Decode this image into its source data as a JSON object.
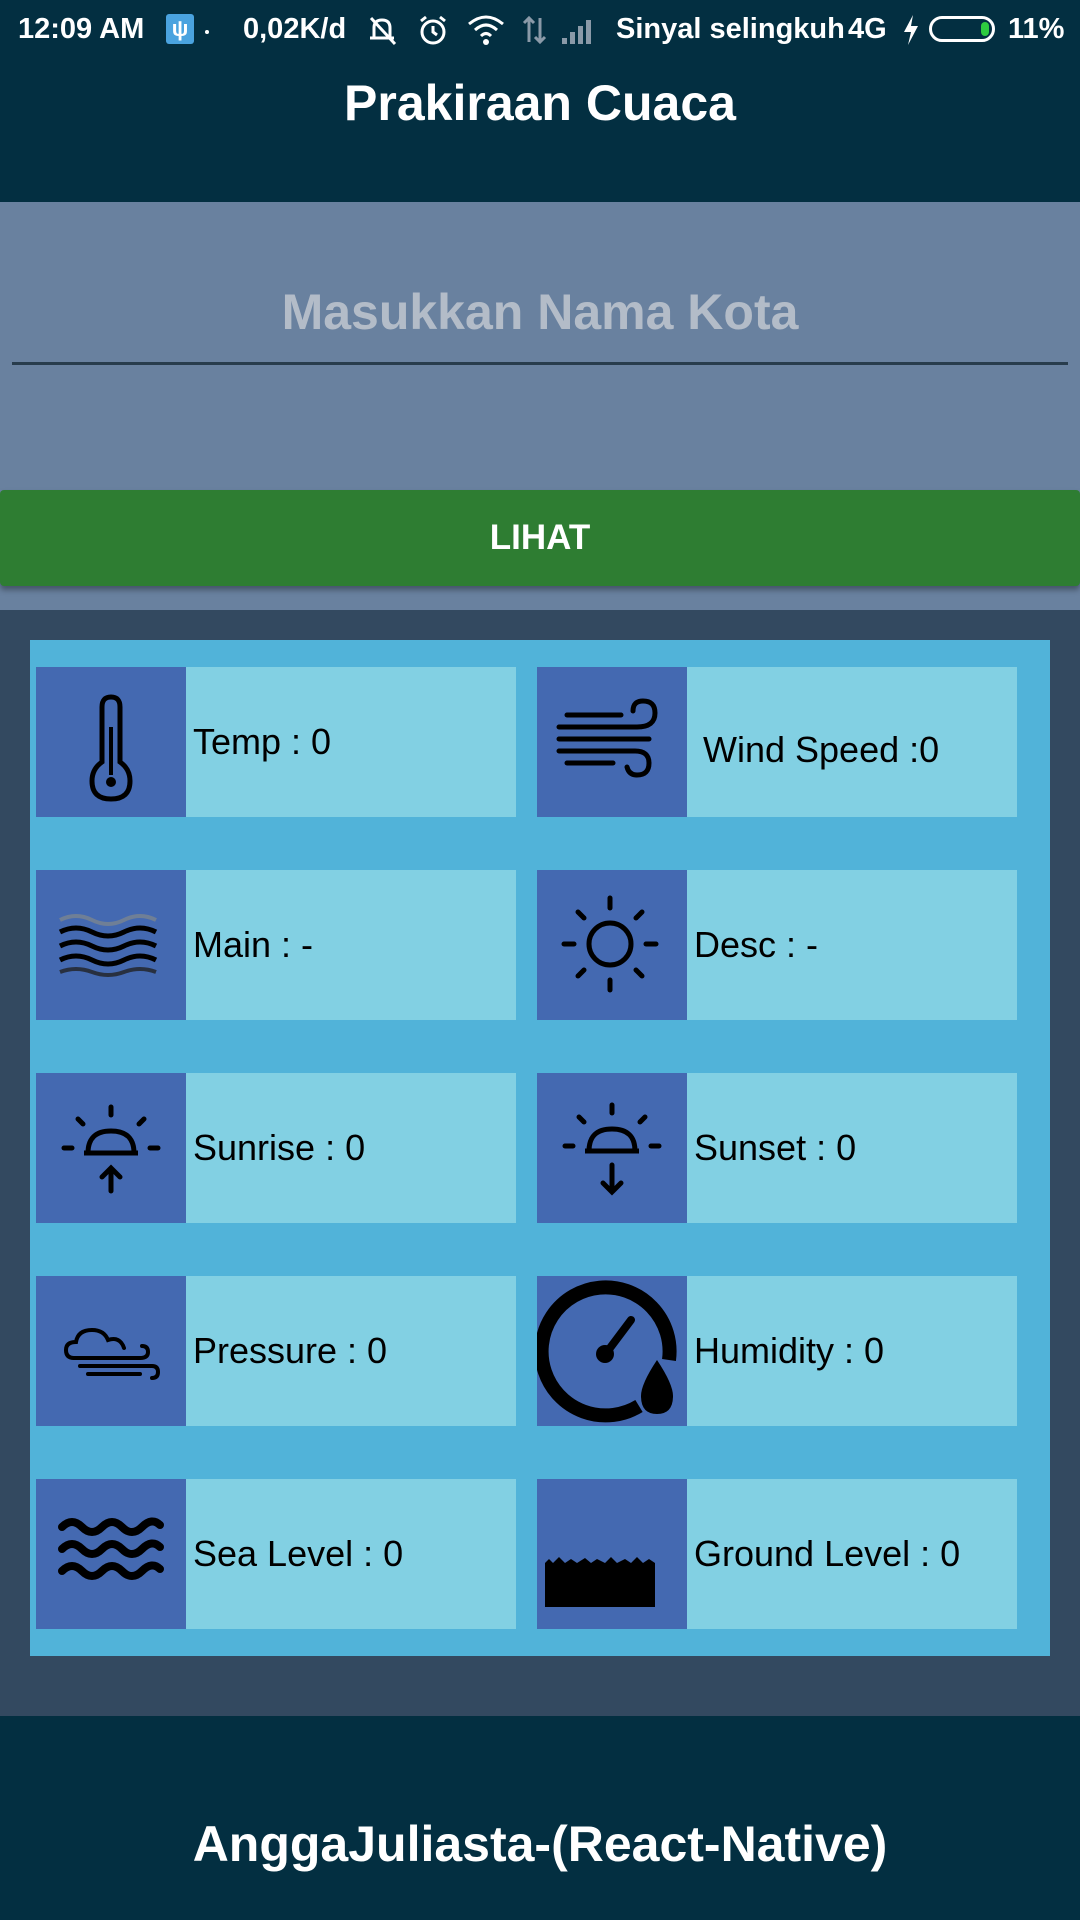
{
  "status_bar": {
    "time": "12:09 AM",
    "network_speed": "0,02K/d",
    "carrier": "Sinyal selingkuh",
    "network_type": "4G",
    "battery": "11%"
  },
  "header": {
    "title": "Prakiraan Cuaca"
  },
  "search": {
    "placeholder": "Masukkan Nama Kota",
    "value": "",
    "button_label": "LIHAT"
  },
  "weather": {
    "temp": "Temp : 0",
    "wind_speed": "Wind Speed :0",
    "main": "Main : -",
    "desc": "Desc : -",
    "sunrise": "Sunrise : 0",
    "sunset": "Sunset : 0",
    "pressure": "Pressure : 0",
    "humidity": "Humidity : 0",
    "sea_level": "Sea Level : 0",
    "ground_level": "Ground Level : 0"
  },
  "footer": {
    "text": "AnggaJuliasta-(React-Native)"
  },
  "colors": {
    "header_bg": "#032f41",
    "input_area_bg": "#69819f",
    "button_bg": "#2e7d32",
    "panel_bg": "#51b3d9",
    "card_bg": "#82d0e3",
    "icon_box_bg": "#4469b1"
  }
}
